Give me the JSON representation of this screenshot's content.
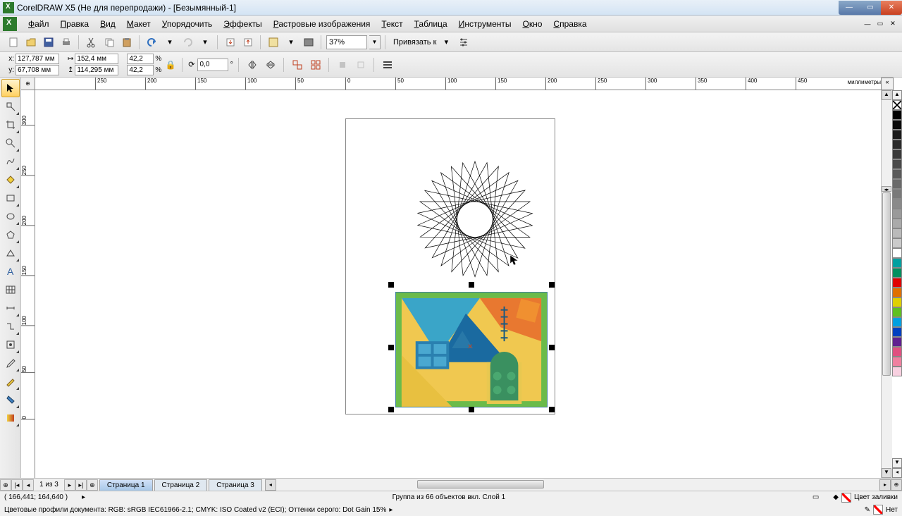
{
  "title": "CorelDRAW X5 (Не для перепродажи) - [Безымянный-1]",
  "menu": [
    "Файл",
    "Правка",
    "Вид",
    "Макет",
    "Упорядочить",
    "Эффекты",
    "Растровые изображения",
    "Текст",
    "Таблица",
    "Инструменты",
    "Окно",
    "Справка"
  ],
  "toolbar": {
    "zoom": "37%",
    "snap_label": "Привязать к"
  },
  "props": {
    "x_label": "x:",
    "y_label": "y:",
    "x": "127,787 мм",
    "y": "67,708 мм",
    "w": "152,4 мм",
    "h": "114,295 мм",
    "sx": "42,2",
    "sy": "42,2",
    "pct": "%",
    "rot": "0,0",
    "deg": "°"
  },
  "ruler": {
    "unit": "миллиметры",
    "h_ticks": [
      -250,
      -200,
      -150,
      -100,
      -50,
      0,
      50,
      100,
      150,
      200,
      250,
      300,
      350,
      400,
      450
    ],
    "v_ticks": [
      300,
      250,
      200,
      150,
      100,
      50,
      0
    ]
  },
  "pages": {
    "count": "1 из 3",
    "tabs": [
      "Страница 1",
      "Страница 2",
      "Страница 3"
    ]
  },
  "status": {
    "coords": "( 166,441; 164,640 )",
    "selection": "Группа из 66 объектов вкл. Слой 1",
    "fill_label": "Цвет заливки",
    "stroke_label": "Нет",
    "profiles": "Цветовые профили документа: RGB: sRGB IEC61966-2.1; CMYK: ISO Coated v2 (ECI); Оттенки серого: Dot Gain 15%"
  },
  "palette": [
    "#000000",
    "#0a0a0a",
    "#1a1a1a",
    "#2a2a2a",
    "#3a3a3a",
    "#4a4a4a",
    "#5a5a5a",
    "#6a6a6a",
    "#7a7a7a",
    "#8a8a8a",
    "#9a9a9a",
    "#aaaaaa",
    "#bababa",
    "#cacaca",
    "#ffffff",
    "#00a0a0",
    "#009060",
    "#e00000",
    "#e07000",
    "#e0d000",
    "#60c020",
    "#00a0e0",
    "#0040c0",
    "#602090",
    "#e05080",
    "#f080a0",
    "#f8d0e0"
  ]
}
